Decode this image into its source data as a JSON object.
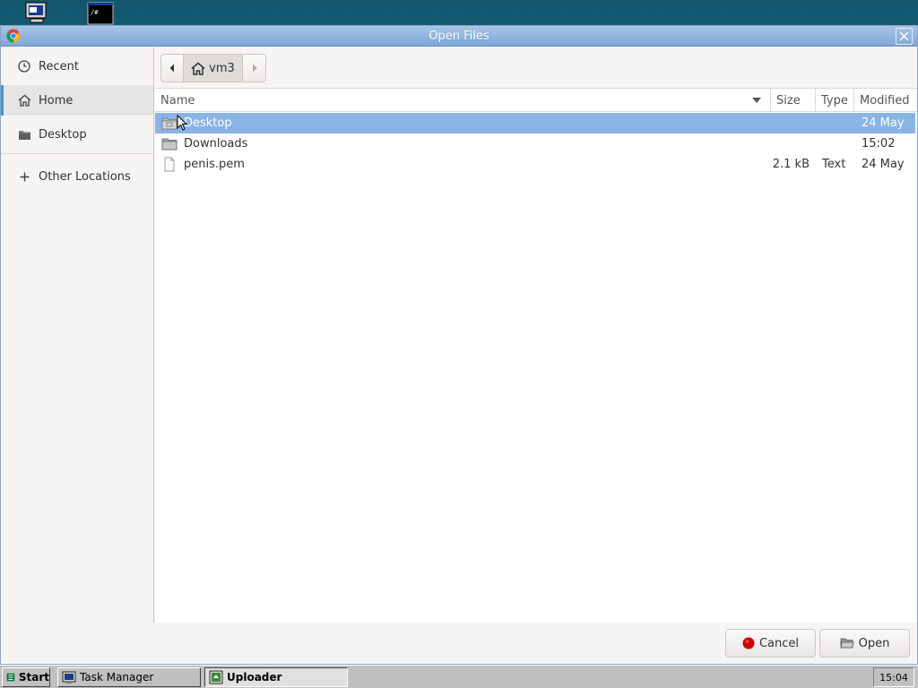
{
  "dialog": {
    "title": "Open Files"
  },
  "sidebar": {
    "items": [
      {
        "label": "Recent",
        "icon": "clock-icon"
      },
      {
        "label": "Home",
        "icon": "home-icon",
        "active": true
      },
      {
        "label": "Desktop",
        "icon": "folder-icon"
      },
      {
        "label": "Other Locations",
        "icon": "plus-icon"
      }
    ]
  },
  "path_bar": {
    "current": "vm3"
  },
  "columns": {
    "name": "Name",
    "size": "Size",
    "type": "Type",
    "modified": "Modified"
  },
  "files": [
    {
      "name": "Desktop",
      "size": "",
      "type": "",
      "modified": "24 May",
      "icon": "folder-icon",
      "selected": true
    },
    {
      "name": "Downloads",
      "size": "",
      "type": "",
      "modified": "15:02",
      "icon": "folder-icon",
      "selected": false
    },
    {
      "name": "penis.pem",
      "size": "2.1 kB",
      "type": "Text",
      "modified": "24 May",
      "icon": "text-file-icon",
      "selected": false
    }
  ],
  "buttons": {
    "cancel": "Cancel",
    "open": "Open"
  },
  "taskbar": {
    "start": "Start",
    "tasks": [
      "Task Manager",
      "Uploader"
    ],
    "clock": "15:04"
  },
  "colors": {
    "selection": "#8ab3e6",
    "titlebar": "#7fa7d8",
    "accent": "#4a90d9"
  }
}
